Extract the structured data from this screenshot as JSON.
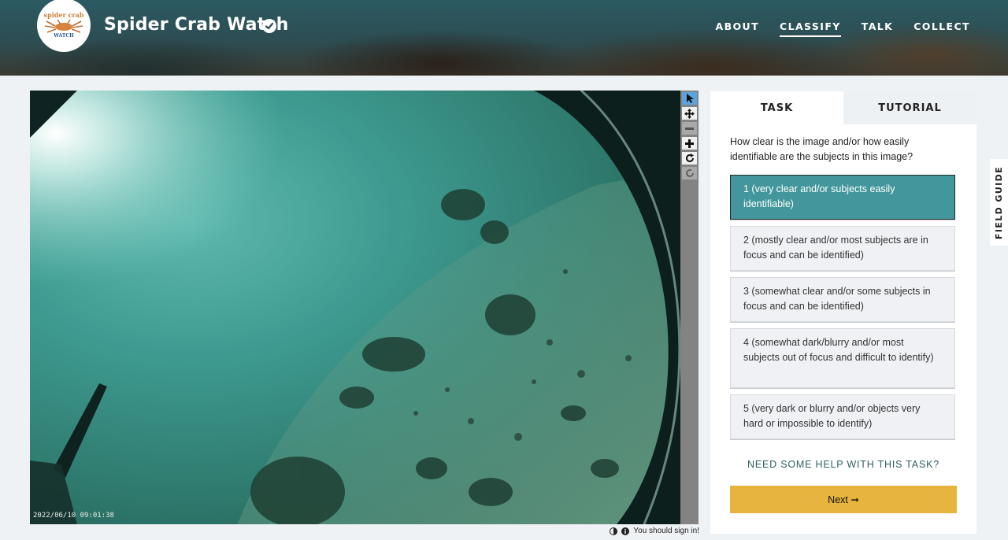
{
  "header": {
    "logo_text_top": "spider crab",
    "logo_text_bottom": "WATCH",
    "title": "Spider Crab Watch",
    "nav": [
      {
        "label": "ABOUT",
        "active": false
      },
      {
        "label": "CLASSIFY",
        "active": true
      },
      {
        "label": "TALK",
        "active": false
      },
      {
        "label": "COLLECT",
        "active": false
      }
    ]
  },
  "subject": {
    "timestamp": "2022/06/10 09:01:38"
  },
  "toolbar": {
    "tools": [
      "pointer-icon",
      "move-icon",
      "zoom-out-icon",
      "zoom-in-icon",
      "rotate-icon",
      "reset-icon"
    ]
  },
  "footer": {
    "signin": "You should sign in!"
  },
  "panel": {
    "tabs": [
      {
        "label": "TASK",
        "active": true
      },
      {
        "label": "TUTORIAL",
        "active": false
      }
    ],
    "question": "How clear is the image and/or how easily identifiable are the subjects in this image?",
    "answers": [
      {
        "label": "1 (very clear and/or subjects easily identifiable)",
        "selected": true
      },
      {
        "label": "2 (mostly clear and/or most subjects are in focus and can be identified)",
        "selected": false
      },
      {
        "label": "3 (somewhat clear and/or some subjects in focus and can be identified)",
        "selected": false
      },
      {
        "label": "4 (somewhat dark/blurry and/or most subjects out of focus and difficult to identify)",
        "selected": false
      },
      {
        "label": "5 (very dark or blurry and/or objects very hard or impossible to identify)",
        "selected": false
      }
    ],
    "help": "NEED SOME HELP WITH THIS TASK?",
    "next": "Next ➞"
  },
  "field_guide": "FIELD GUIDE",
  "colors": {
    "selected_answer": "#43979c",
    "next_button": "#e7b53d",
    "toolbar": "#838383",
    "active_tool": "#5aa3dd"
  }
}
